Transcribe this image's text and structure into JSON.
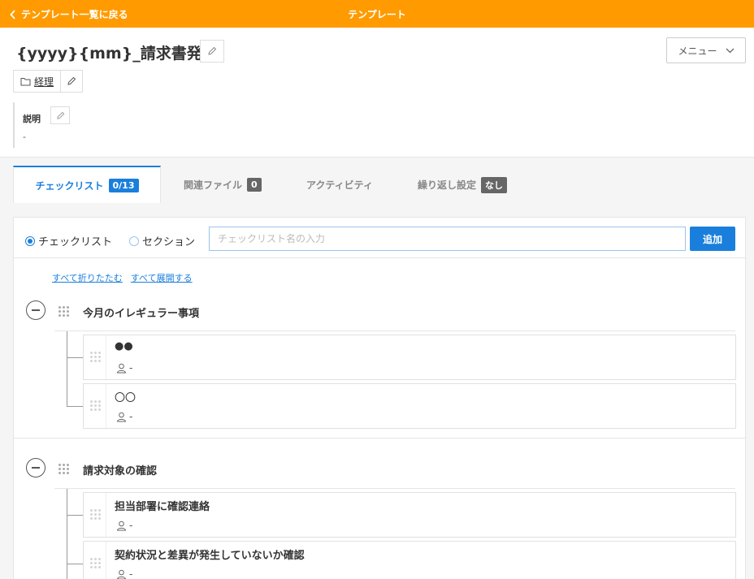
{
  "topbar": {
    "back_label": "テンプレート一覧に戻る",
    "title": "テンプレート"
  },
  "header": {
    "template_title": "{yyyy}{mm}_請求書発行",
    "menu_label": "メニュー",
    "folder_label": "経理",
    "description_label": "説明",
    "description_value": "-"
  },
  "tabs": [
    {
      "label": "チェックリスト",
      "badge": "0/13",
      "active": true
    },
    {
      "label": "関連ファイル",
      "badge": "0"
    },
    {
      "label": "アクティビティ"
    },
    {
      "label": "繰り返し設定",
      "badge": "なし"
    }
  ],
  "add_row": {
    "radio_checklist": "チェックリスト",
    "radio_section": "セクション",
    "input_placeholder": "チェックリスト名の入力",
    "add_label": "追加"
  },
  "links": {
    "collapse_all": "すべて折りたたむ",
    "expand_all": "すべて展開する"
  },
  "sections": [
    {
      "title": "今月のイレギュラー事項",
      "items": [
        {
          "name": "●●",
          "assignee": "-"
        },
        {
          "name": "〇〇",
          "assignee": "-"
        }
      ]
    },
    {
      "title": "請求対象の確認",
      "items": [
        {
          "name": "担当部署に確認連絡",
          "assignee": "-"
        },
        {
          "name": "契約状況と差異が発生していないか確認",
          "assignee": "-"
        }
      ]
    }
  ],
  "colors": {
    "accent_orange": "#ff9b00",
    "primary_blue": "#1a7fdc"
  }
}
